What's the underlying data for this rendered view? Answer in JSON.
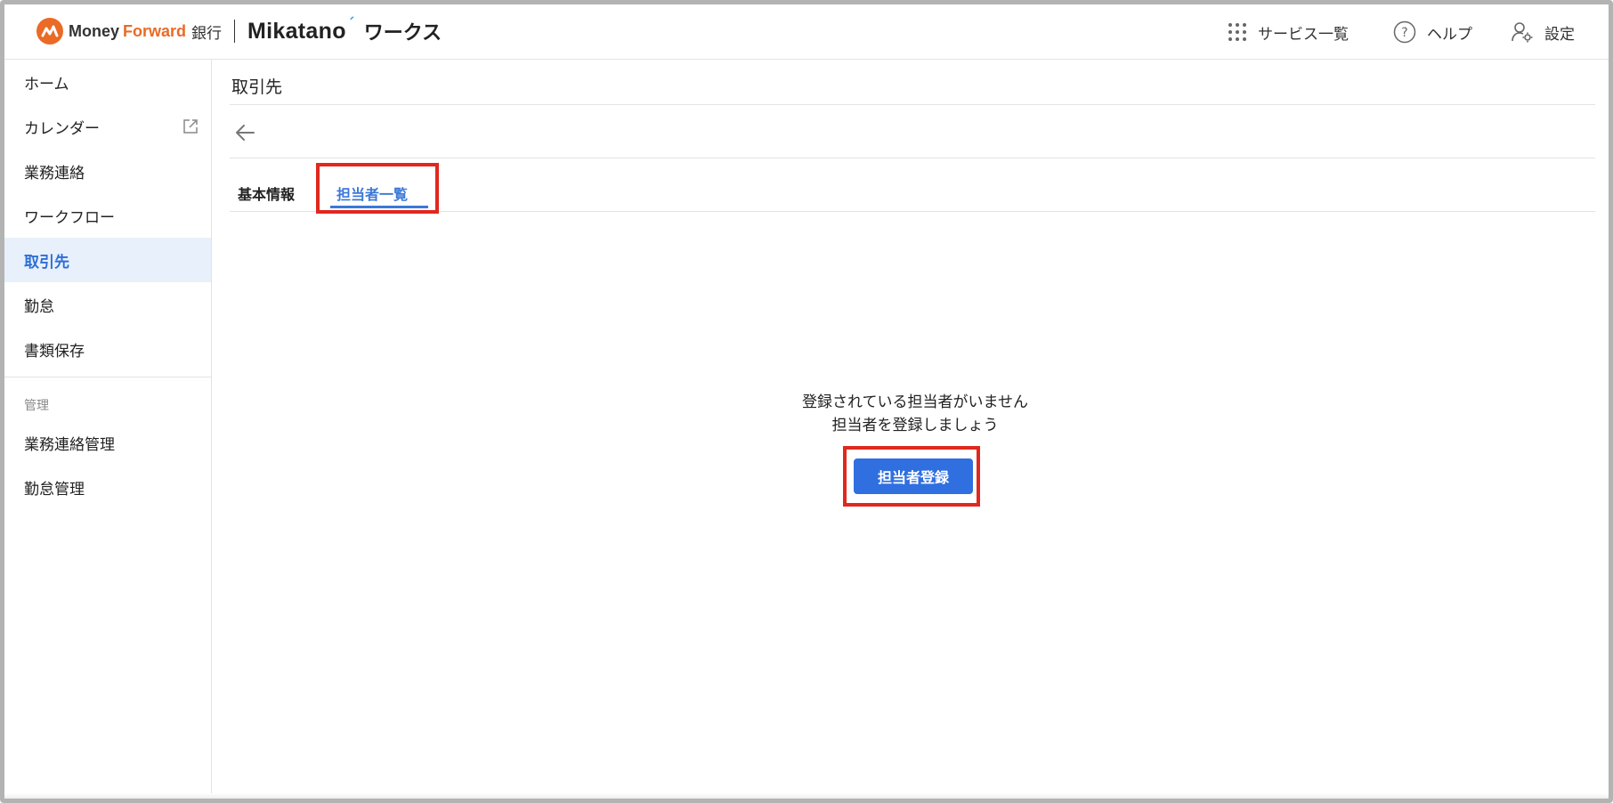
{
  "header": {
    "brand_money": "Money",
    "brand_forward": "Forward",
    "brand_bank": "銀行",
    "brand_mikatano": "Mikatano",
    "brand_works": "ワークス",
    "nav": {
      "services_label": "サービス一覧",
      "help_label": "ヘルプ",
      "settings_label": "設定"
    }
  },
  "sidebar": {
    "items": [
      {
        "label": "ホーム"
      },
      {
        "label": "カレンダー"
      },
      {
        "label": "業務連絡"
      },
      {
        "label": "ワークフロー"
      },
      {
        "label": "取引先",
        "active": true
      },
      {
        "label": "勤怠"
      },
      {
        "label": "書類保存"
      }
    ],
    "section_label": "管理",
    "admin_items": [
      {
        "label": "業務連絡管理"
      },
      {
        "label": "勤怠管理"
      }
    ]
  },
  "main": {
    "page_title": "取引先",
    "tabs": [
      {
        "label": "基本情報"
      },
      {
        "label": "担当者一覧",
        "active": true
      }
    ],
    "empty_state": {
      "line1": "登録されている担当者がいません",
      "line2": "担当者を登録しましょう",
      "button_label": "担当者登録"
    }
  },
  "colors": {
    "brand_orange": "#ea6a26",
    "accent_blue": "#2f6fe0",
    "active_bg": "#e8f0fb",
    "highlight_red": "#e0281e"
  },
  "icons": {
    "services": "grid-dots-icon",
    "help": "question-circle-icon",
    "settings": "user-gear-icon",
    "calendar_external": "external-link-icon",
    "back": "arrow-left-icon"
  }
}
